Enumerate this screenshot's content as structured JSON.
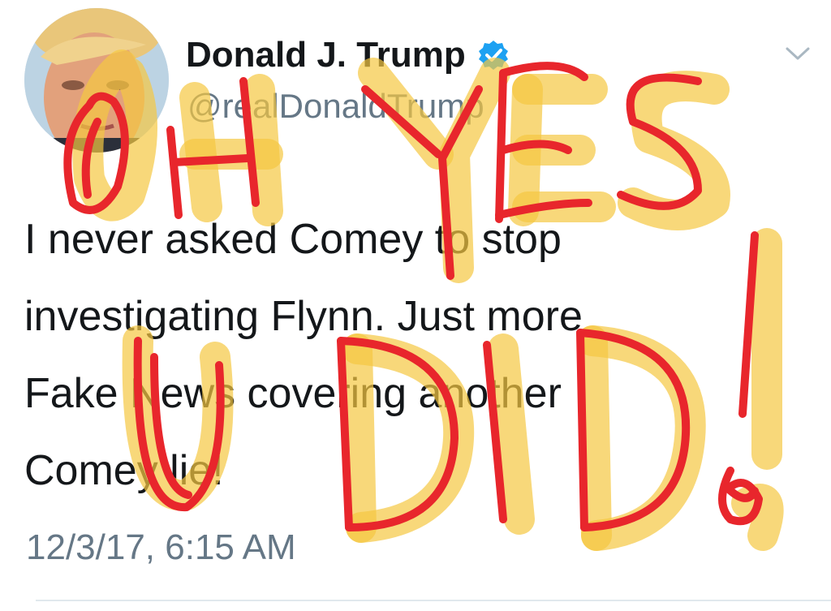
{
  "tweet": {
    "display_name": "Donald J. Trump",
    "handle": "@realDonaldTrump",
    "verified": true,
    "text_lines": [
      "I never asked Comey to stop",
      "investigating Flynn. Just more",
      "Fake News covering another",
      "Comey lie!"
    ],
    "timestamp": "12/3/17, 6:15 AM"
  },
  "icons": {
    "verified": "verified-badge-icon",
    "menu": "chevron-down-icon",
    "avatar": "profile-photo"
  },
  "annotation": {
    "words": [
      "OH YES",
      "U DID!"
    ],
    "colors": {
      "highlighter": "#f5c842",
      "marker": "#e8262c"
    }
  },
  "colors": {
    "text": "#14171a",
    "secondary": "#657786",
    "verified": "#1da1f2",
    "divider": "#e1e8ed"
  }
}
